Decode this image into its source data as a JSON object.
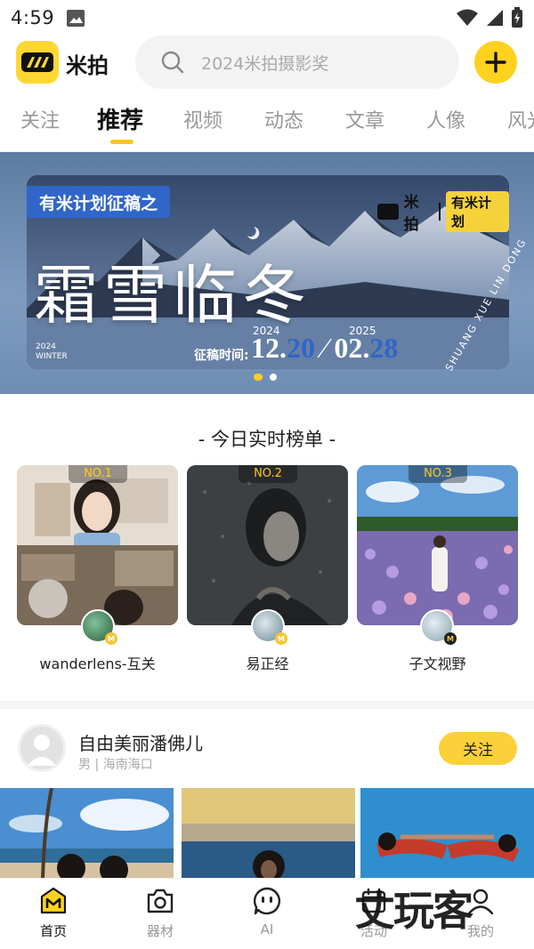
{
  "status_bar": {
    "time": "4:59"
  },
  "header": {
    "brand": "米拍",
    "search_placeholder": "2024米拍摄影奖"
  },
  "tabs": [
    "关注",
    "推荐",
    "视频",
    "动态",
    "文章",
    "人像",
    "风光"
  ],
  "active_tab": "推荐",
  "banner": {
    "badge": "有米计划征稿之",
    "logo_text": "米拍",
    "plan_text": "有米计划",
    "title": "霜雪临冬",
    "date_label": "征稿时间:",
    "start_year": "2024",
    "start_date_a": "12.",
    "start_date_b": "20",
    "end_year": "2025",
    "end_date_a": "02.",
    "end_date_b": "28",
    "winter_year": "2024",
    "winter_text": "WINTER",
    "vertical_text": "SHUANG XUE LIN DONG",
    "slide_count": 2,
    "active_slide": 1
  },
  "ranking": {
    "title": "- 今日实时榜单 -",
    "items": [
      {
        "rank": "NO.1",
        "name": "wanderlens-互关"
      },
      {
        "rank": "NO.2",
        "name": "易正经"
      },
      {
        "rank": "NO.3",
        "name": "子文视野"
      }
    ]
  },
  "feed": {
    "user_name": "自由美丽潘佛儿",
    "user_meta": "男 | 海南海口",
    "follow_label": "关注"
  },
  "bottom_nav": {
    "items": [
      "首页",
      "器材",
      "AI",
      "活动",
      "我的"
    ],
    "active": "首页"
  },
  "watermark": "丈玩客",
  "colors": {
    "accent": "#ffd21f",
    "banner_blue": "#2f66c8"
  }
}
